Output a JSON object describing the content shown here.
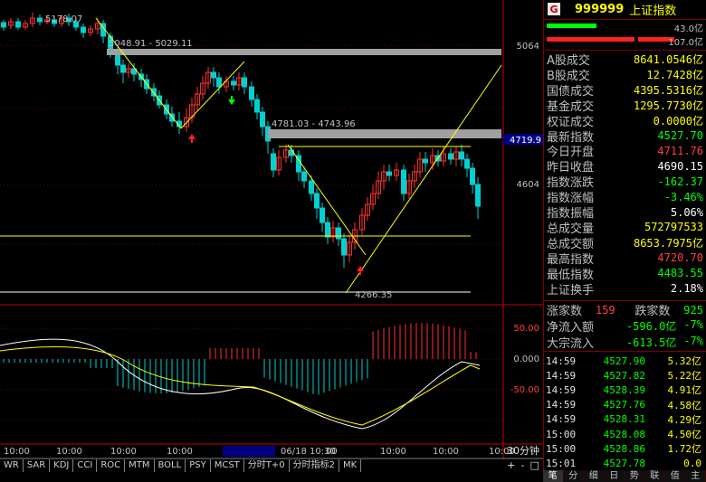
{
  "header": {
    "code": "999999",
    "name": "上证指数",
    "badge": "G"
  },
  "breadth_bar": {
    "up_label": "43.0亿",
    "down_label": "107.0亿"
  },
  "quote_rows": [
    {
      "label": "A股成交",
      "value": "8641.0546亿",
      "color": "#ffff00"
    },
    {
      "label": "B股成交",
      "value": "12.7428亿",
      "color": "#ffff00"
    },
    {
      "label": "国债成交",
      "value": "4395.5316亿",
      "color": "#ffff00"
    },
    {
      "label": "基金成交",
      "value": "1295.7730亿",
      "color": "#ffff00"
    },
    {
      "label": "权证成交",
      "value": "0.0000亿",
      "color": "#ffff00"
    },
    {
      "label": "最新指数",
      "value": "4527.70",
      "color": "#00ff00"
    },
    {
      "label": "今日开盘",
      "value": "4711.76",
      "color": "#ff4040"
    },
    {
      "label": "昨日收盘",
      "value": "4690.15",
      "color": "#ffffff"
    },
    {
      "label": "指数涨跌",
      "value": "-162.37",
      "color": "#00ff00"
    },
    {
      "label": "指数涨幅",
      "value": "-3.46%",
      "color": "#00ff00"
    },
    {
      "label": "指数振幅",
      "value": "5.06%",
      "color": "#ffffff"
    },
    {
      "label": "总成交量",
      "value": "572797533",
      "color": "#ffff00"
    },
    {
      "label": "总成交额",
      "value": "8653.7975亿",
      "color": "#ffff00"
    },
    {
      "label": "最高指数",
      "value": "4720.70",
      "color": "#ff4040"
    },
    {
      "label": "最低指数",
      "value": "4483.55",
      "color": "#00ff00"
    },
    {
      "label": "上证换手",
      "value": "2.18%",
      "color": "#ffffff"
    }
  ],
  "breadth": {
    "up_label": "涨家数",
    "up": "159",
    "down_label": "跌家数",
    "down": "925"
  },
  "flows": [
    {
      "label": "净流入额",
      "value": "-596.0亿",
      "pct": "-7%"
    },
    {
      "label": "大宗流入",
      "value": "-613.5亿",
      "pct": "-7%"
    }
  ],
  "ticks": [
    {
      "time": "14:59",
      "price": "4527.90",
      "vol": "5.32亿"
    },
    {
      "time": "14:59",
      "price": "4527.82",
      "vol": "5.22亿"
    },
    {
      "time": "14:59",
      "price": "4528.39",
      "vol": "4.91亿"
    },
    {
      "time": "14:59",
      "price": "4527.76",
      "vol": "4.58亿"
    },
    {
      "time": "14:59",
      "price": "4528.31",
      "vol": "4.29亿"
    },
    {
      "time": "15:00",
      "price": "4528.08",
      "vol": "4.50亿"
    },
    {
      "time": "15:00",
      "price": "4528.86",
      "vol": "1.72亿"
    },
    {
      "time": "15:01",
      "price": "4527.78",
      "vol": "0.0"
    }
  ],
  "bottom_tabs": [
    "笔",
    "分",
    "细",
    "日",
    "势",
    "联",
    "值",
    "主"
  ],
  "chart": {
    "price_axis_labels": [
      "5064",
      "4719.9",
      "4604"
    ],
    "macd_axis_labels": [
      "50.00",
      "0.000",
      "-50.00"
    ],
    "annotations": {
      "high_label": "5178.07",
      "resistance1": "5048.91 - 5029.11",
      "resistance2": "4781.03 - 4743.96",
      "low_label": "4266.35"
    },
    "time_labels": [
      "10:00",
      "10:00",
      "10:00",
      "10:00",
      "10:00",
      "06/18 10:30",
      "00",
      "10:00",
      "10:00",
      "10:00"
    ],
    "period": "30分钟",
    "zoom": [
      "+",
      "-",
      "□"
    ]
  },
  "indicator_tabs": [
    "WR",
    "SAR",
    "KDJ",
    "CCI",
    "ROC",
    "MTM",
    "BOLL",
    "PSY",
    "MCST",
    "分时T+0",
    "分时指标2",
    "MK"
  ]
}
